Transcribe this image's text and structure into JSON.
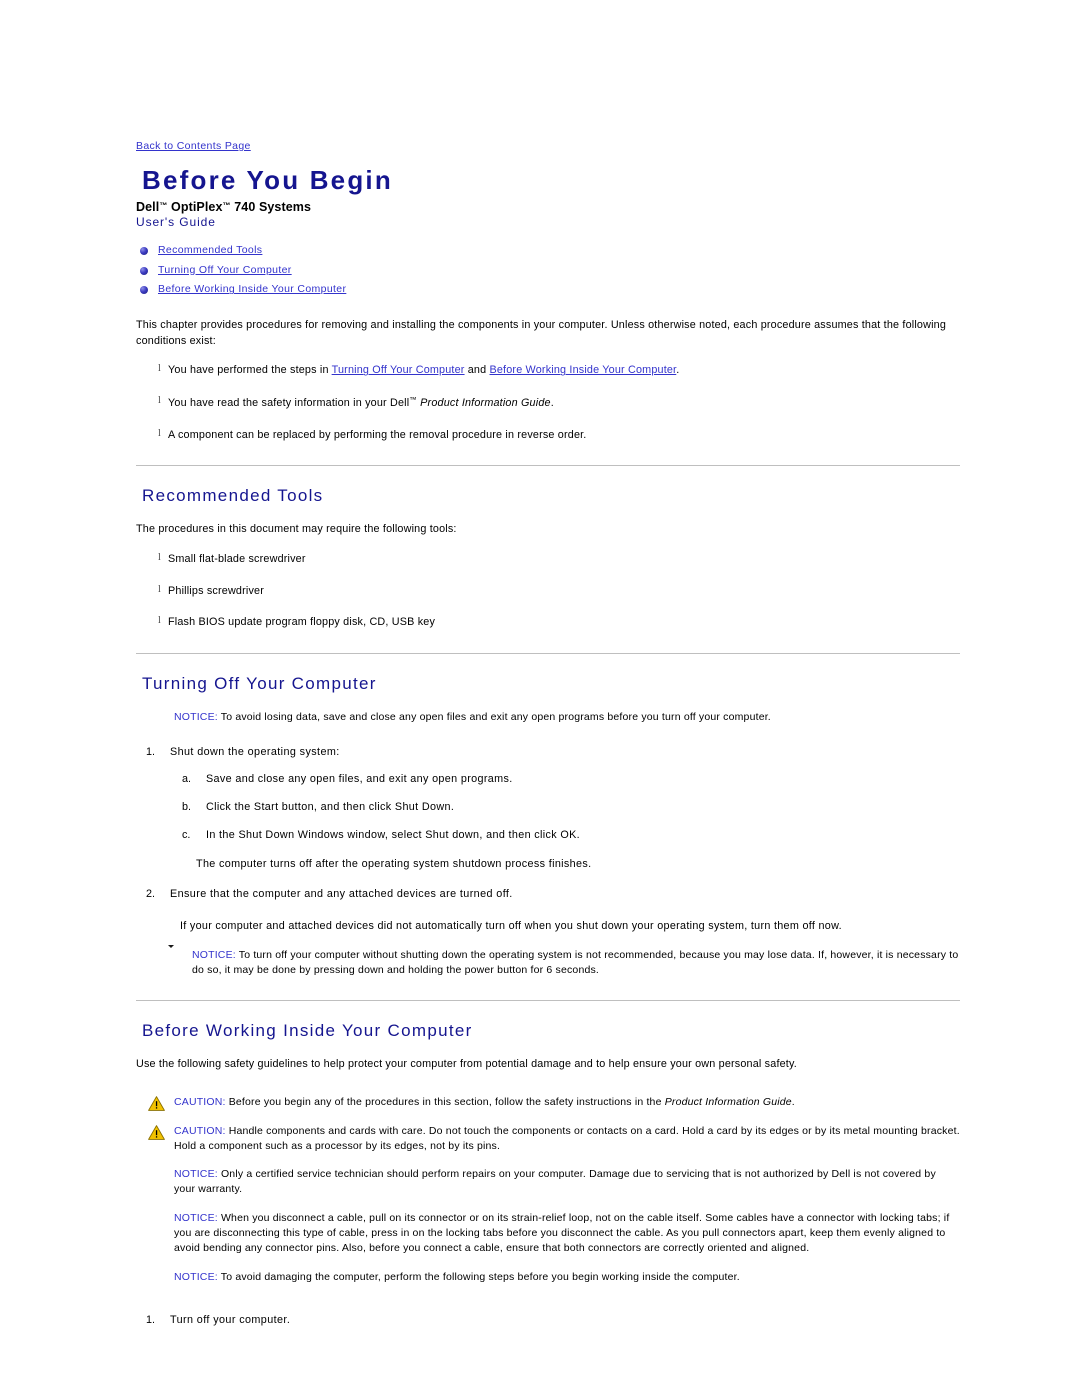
{
  "colors": {
    "heading_blue": "#15158f",
    "link_blue": "#3333cc",
    "rule_gray": "#bfbfbf",
    "caution_yellow": "#f2c200",
    "icon_black": "#0d0d0d"
  },
  "header": {
    "back_link": "Back to Contents Page",
    "title": "Before You Begin",
    "model_line_pre": "Dell",
    "model_line_mid": " OptiPlex",
    "model_line_post": " 740 Systems",
    "tm": "™",
    "guide": "User's Guide"
  },
  "toc": {
    "items": [
      {
        "label": "Recommended Tools"
      },
      {
        "label": "Turning Off Your Computer"
      },
      {
        "label": "Before Working Inside Your Computer"
      }
    ]
  },
  "intro": {
    "paragraph": "This chapter provides procedures for removing and installing the components in your computer. Unless otherwise noted, each procedure assumes that the following conditions exist:",
    "conditions": [
      {
        "pre": "You have performed the steps in ",
        "link1": "Turning Off Your Computer",
        "mid": " and ",
        "link2": "Before Working Inside Your Computer",
        "post": "."
      },
      {
        "pre": "You have read the safety information in your Dell",
        "tm": "™",
        "italic": " Product Information Guide",
        "post": "."
      },
      {
        "pre": "A component can be replaced by performing the removal procedure in reverse order.",
        "italic": "",
        "post": ""
      }
    ]
  },
  "recommended_tools": {
    "heading": "Recommended Tools",
    "paragraph": "The procedures in this document may require the following tools:",
    "tools": [
      "Small flat-blade screwdriver",
      "Phillips screwdriver",
      "Flash BIOS update program floppy disk, CD, USB key"
    ]
  },
  "turning_off": {
    "heading": "Turning Off Your Computer",
    "notice_top": {
      "icon": "notice-arrow-icon",
      "label": "NOTICE:",
      "text": " To avoid losing data, save and close any open files and exit any open programs before you turn off your computer."
    },
    "steps": [
      {
        "num": "1.",
        "text": "Shut down the operating system:",
        "substeps": [
          {
            "num": "a.",
            "text": "Save and close any open files, and exit any open programs."
          },
          {
            "num": "b.",
            "text": "Click the Start button, and then click Shut Down."
          },
          {
            "num": "c.",
            "text": "In the Shut Down Windows window, select Shut down, and then click OK."
          }
        ],
        "trailing": "The computer turns off after the operating system shutdown process finishes."
      },
      {
        "num": "2.",
        "text": "Ensure that the computer and any attached devices are turned off.",
        "substeps": [],
        "trailing": "If your computer and attached devices did not automatically turn off when you shut down your operating system, turn them off now."
      }
    ],
    "notice_bottom": {
      "icon": "note-pencil-icon",
      "label": "NOTICE:",
      "text": " To turn off your computer without shutting down the operating system is not recommended, because you may lose data. If, however, it is necessary to do so, it may be done by pressing down and holding the power button for 6 seconds."
    }
  },
  "before_working": {
    "heading": "Before Working Inside Your Computer",
    "paragraph": "Use the following safety guidelines to help protect your computer from potential damage and to help ensure your own personal safety.",
    "admonitions": [
      {
        "type": "caution",
        "icon": "caution-triangle-icon",
        "label": "CAUTION:",
        "text": " Before you begin any of the procedures in this section, follow the safety instructions in the ",
        "italic": "Product Information Guide",
        "post": "."
      },
      {
        "type": "caution",
        "icon": "caution-triangle-icon",
        "label": "CAUTION:",
        "text": " Handle components and cards with care. Do not touch the components or contacts on a card. Hold a card by its edges or by its metal mounting bracket. Hold a component such as a processor by its edges, not by its pins.",
        "italic": "",
        "post": ""
      },
      {
        "type": "notice",
        "icon": "notice-arrow-icon",
        "label": "NOTICE:",
        "text": " Only a certified service technician should perform repairs on your computer. Damage due to servicing that is not authorized by Dell is not covered by your warranty.",
        "italic": "",
        "post": ""
      },
      {
        "type": "notice",
        "icon": "notice-arrow-icon",
        "label": "NOTICE:",
        "text": " When you disconnect a cable, pull on its connector or on its strain-relief loop, not on the cable itself. Some cables have a connector with locking tabs; if you are disconnecting this type of cable, press in on the locking tabs before you disconnect the cable. As you pull connectors apart, keep them evenly aligned to avoid bending any connector pins. Also, before you connect a cable, ensure that both connectors are correctly oriented and aligned.",
        "italic": "",
        "post": ""
      },
      {
        "type": "notice",
        "icon": "notice-arrow-icon",
        "label": "NOTICE:",
        "text": " To avoid damaging the computer, perform the following steps before you begin working inside the computer.",
        "italic": "",
        "post": ""
      }
    ],
    "steps": [
      {
        "num": "1.",
        "text": "Turn off your computer."
      }
    ]
  }
}
